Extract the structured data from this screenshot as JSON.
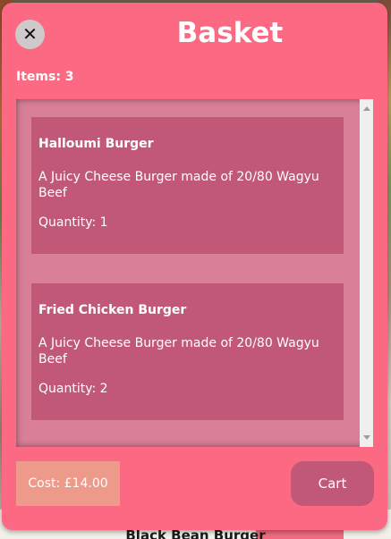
{
  "modal": {
    "title": "Basket",
    "close_glyph": "✕",
    "items_count_label": "Items: 3",
    "cost_label": "Cost: £14.00",
    "cart_button_label": "Cart"
  },
  "basket_items": [
    {
      "name": "Halloumi Burger",
      "description": "A Juicy Cheese Burger made of 20/80 Wagyu Beef",
      "quantity_label": "Quantity: 1"
    },
    {
      "name": "Fried Chicken Burger",
      "description": "A Juicy Cheese Burger made of 20/80 Wagyu Beef",
      "quantity_label": "Quantity: 2"
    }
  ],
  "background_page": {
    "partial_item_title": "Black Bean Burger"
  },
  "colors": {
    "modal_bg": "#fc6982",
    "card_bg": "#c25877",
    "list_bg": "#d97f98",
    "cost_bg": "#ee9a8b"
  }
}
